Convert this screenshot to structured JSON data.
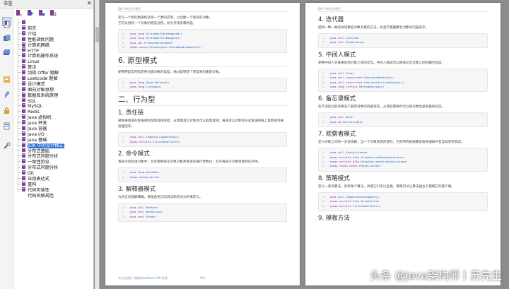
{
  "panel": {
    "title": "书签",
    "close_glyph": "×",
    "items": [
      "前言",
      "介绍",
      "性能调优问题",
      "计算机网络",
      "HTTP",
      "计算机操作系统",
      "Linux",
      "算法",
      "剑指 Offer 题解",
      "Leetcode 题解",
      "设计模式",
      "面向对象思想",
      "数据库系统原理",
      "SQL",
      "MySQL",
      "Redis",
      "Java 虚拟机",
      "Java 并发",
      "Java 容器",
      "Java I/O",
      "Java 基础",
      "JDK 中的设计模式",
      "分布式基础",
      "分布式问题分析",
      "一致性协议",
      "分布式问题分析",
      "Git",
      "正则表达式",
      "重构",
      "代码可读性",
      "代码风格规范"
    ],
    "selected_index": 21
  },
  "left_page": {
    "header": "JDK 中的设计模式",
    "intro_1": "定义一个新的类来构造另一个类的实例，以创建一个复杂的对象。",
    "intro_2": "它可以封装一个对象的构造过程，并允许按步骤构造。",
    "code_1": [
      "java.lang.StringBuilder#append()",
      "java.lang.StringBuffer#append()",
      "java.sql.PreparedStatement",
      "javax.swing.GroupLayout.Group#addComponent()"
    ],
    "h_prototype": "6. 原型模式",
    "prototype_desc": "使用原型实例指定要创建对象的类型；通过复制这个原型来创建新对象。",
    "code_2": [
      "java.lang.Object#clone()",
      "java.lang.Cloneable"
    ],
    "h_behavior": "二、行为型",
    "h_chain": "1. 责任链",
    "chain_desc_1": "避免将请求的发送者附加到其接收者，从而使其它对象也可以处理请求；将请求以对象的方式发送到链上直到请求被",
    "chain_desc_2": "处理完毕。",
    "code_3": [
      "java.util.logging.Logger#log()",
      "javax.servlet.Filter#doFilter()"
    ],
    "h_command": "2. 命令模式",
    "command_desc": "将命令封装进对象中；允许使用命令对象对象并使请求进行参数化；允许将命令对象存放到队列中。",
    "code_4": [
      "java.lang.Runnable",
      "javax.swing.Action"
    ],
    "h_interpreter": "3. 解释器模式",
    "interpreter_desc": "为语言创建解释器，通常由语言的语法和语法分析来定义。",
    "code_5": [
      "java.util.Pattern",
      "java.text.Normalizer",
      "java.text.Format"
    ],
    "footer_left": "本文档使用 ",
    "footer_link": "书栈(BookStack.CN)",
    "footer_right": " 构建",
    "page_no": "- 546 -"
  },
  "right_page": {
    "header": "JDK 中的设计模式",
    "h_iterator": "4. 迭代器",
    "iterator_desc": "提供一种一致的访问聚合对象元素的方法，并且不暴露聚合对象的内部表示。",
    "code_1": [
      "java.util.Iterator",
      "java.util.Enumeration"
    ],
    "h_mediator": "5. 中间人模式",
    "mediator_desc": "使用中间人对象来封装对象之间的交互。中间人模式可以降低交互对象之间的耦合程度。",
    "code_2": [
      "java.util.Timer",
      "java.util.concurrent.Executor#execute()",
      "java.util.concurrent.ExecutorService#submit()",
      "java.lang.reflect.Method#invoke()"
    ],
    "h_memento": "6. 备忘录模式",
    "memento_desc": "在不违反封装的情况下获得对象的内部状态，从而在需要时可以将对象恢复到最初状态。",
    "code_3": [
      "java.util.Date",
      "java.io.Serializable"
    ],
    "h_observer": "7. 观察者模式",
    "observer_desc": "定义对象之间的一对多依赖，当一个对象状态改变时，它的所有依赖都会收到通知并且自动更新状态。",
    "code_4": [
      "java.util.EventListener",
      "javax.servlet.http.HttpSessionBindingListener",
      "javax.servlet.http.HttpSessionAttributeListener",
      "javax.faces.event.PhaseListener"
    ],
    "h_strategy": "8. 策略模式",
    "strategy_desc": "定义一系列算法，封装每个算法，并使它们可以互换。策略可以让算法独立于使用它的客户端。",
    "code_5": [
      "java.util.Comparator#compare()",
      "javax.servlet.http.HttpServlet",
      "javax.servlet.Filter#doFilter()"
    ],
    "h_template": "9. 模板方法"
  },
  "watermark": "头条 @Java架构师丨苏先生"
}
